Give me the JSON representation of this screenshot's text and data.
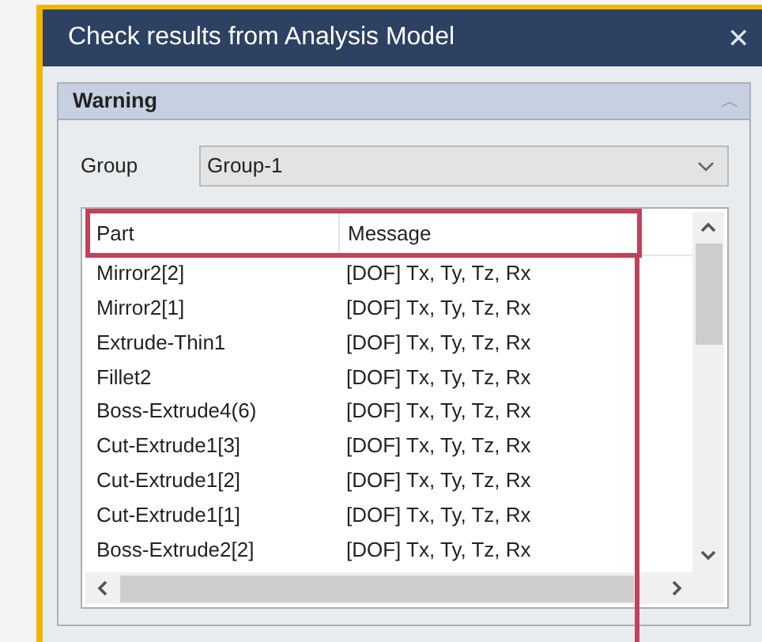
{
  "window": {
    "title": "Check results from Analysis Model",
    "close": "✕"
  },
  "panel": {
    "title": "Warning",
    "collapse": "︿",
    "expanded": true
  },
  "group": {
    "label": "Group",
    "value": "Group-1"
  },
  "table": {
    "columns": [
      "Part",
      "Message"
    ],
    "rows": [
      {
        "part": "Mirror2[2]",
        "message": "[DOF] Tx, Ty, Tz, Rx"
      },
      {
        "part": "Mirror2[1]",
        "message": "[DOF] Tx, Ty, Tz, Rx"
      },
      {
        "part": "Extrude-Thin1",
        "message": "[DOF] Tx, Ty, Tz, Rx"
      },
      {
        "part": "Fillet2",
        "message": "[DOF] Tx, Ty, Tz, Rx"
      },
      {
        "part": "Boss-Extrude4(6)",
        "message": "[DOF] Tx, Ty, Tz, Rx"
      },
      {
        "part": "Cut-Extrude1[3]",
        "message": "[DOF] Tx, Ty, Tz, Rx"
      },
      {
        "part": "Cut-Extrude1[2]",
        "message": "[DOF] Tx, Ty, Tz, Rx"
      },
      {
        "part": "Cut-Extrude1[1]",
        "message": "[DOF] Tx, Ty, Tz, Rx"
      },
      {
        "part": "Boss-Extrude2[2]",
        "message": "[DOF] Tx, Ty, Tz, Rx"
      }
    ]
  },
  "annotation": {
    "kind": "outline",
    "color": "#c0435a"
  }
}
